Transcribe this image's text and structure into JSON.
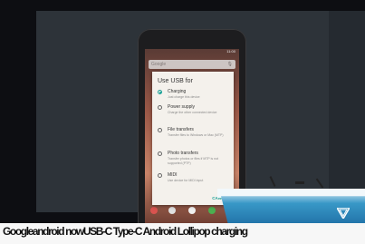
{
  "phone": {
    "status_time": "11:00",
    "search_text": "Google",
    "search_mic": "🎙"
  },
  "dialog": {
    "title": "Use USB for",
    "options": [
      {
        "title": "Charging",
        "subtitle": "Just charge this device",
        "selected": true
      },
      {
        "title": "Power supply",
        "subtitle": "Charge the other connected device",
        "selected": false
      },
      {
        "title": "File transfers",
        "subtitle": "Transfer files to Windows or Mac (MTP)",
        "selected": false
      },
      {
        "title": "Photo transfers",
        "subtitle": "Transfer photos or files if MTP is not supported (PTP)",
        "selected": false
      },
      {
        "title": "MIDI",
        "subtitle": "Use device for MIDI input",
        "selected": false
      }
    ],
    "cancel_label": "CANCEL"
  },
  "caption": "Googleandroid nowUSB-C Type-C Android Lollipop charging",
  "colors": {
    "accent": "#17a096",
    "podium": "#1b68a0"
  }
}
